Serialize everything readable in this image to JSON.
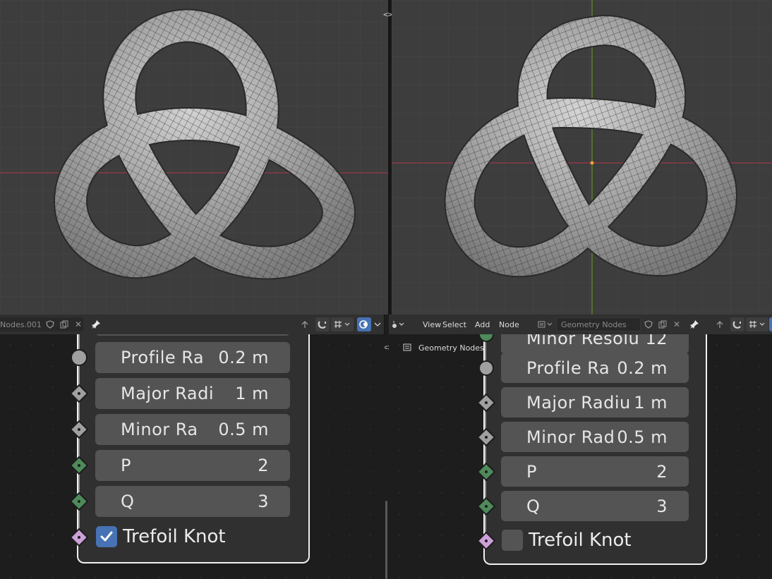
{
  "left_header": {
    "node_tree_name": "Nodes.001"
  },
  "right_header": {
    "menus": [
      "View",
      "Select",
      "Add",
      "Node"
    ],
    "node_tree_name": "Geometry Nodes"
  },
  "right_editor": {
    "breadcrumb": "Geometry Nodes"
  },
  "left_node": {
    "fields": [
      {
        "label": "Profile Ra",
        "value": "0.2 m",
        "socket": "circle"
      },
      {
        "label": "Major Radi",
        "value": "1 m",
        "socket": "diamond-gray"
      },
      {
        "label": "Minor Ra",
        "value": "0.5 m",
        "socket": "diamond-gray"
      },
      {
        "label": "P",
        "value": "2",
        "socket": "diamond-green"
      },
      {
        "label": "Q",
        "value": "3",
        "socket": "diamond-green"
      }
    ],
    "toggle_label": "Trefoil Knot",
    "toggle_checked": true
  },
  "right_node": {
    "top_partial": {
      "label": "Minor Resolu",
      "value": "12"
    },
    "fields": [
      {
        "label": "Profile Ra",
        "value": "0.2 m",
        "socket": "circle"
      },
      {
        "label": "Major Radiu",
        "value": "1 m",
        "socket": "diamond-gray"
      },
      {
        "label": "Minor Rad",
        "value": "0.5 m",
        "socket": "diamond-gray"
      },
      {
        "label": "P",
        "value": "2",
        "socket": "diamond-green"
      },
      {
        "label": "Q",
        "value": "3",
        "socket": "diamond-green"
      }
    ],
    "toggle_label": "Trefoil Knot",
    "toggle_checked": false
  },
  "colors": {
    "viewport_bg": "#3d3d3d",
    "x_axis": "#9c3a45",
    "y_axis": "#5d8a2a",
    "socket_green": "#4e8a5a",
    "socket_gray": "#a0a0a0",
    "socket_pink": "#cda0d8",
    "accent_blue": "#4772b3"
  }
}
